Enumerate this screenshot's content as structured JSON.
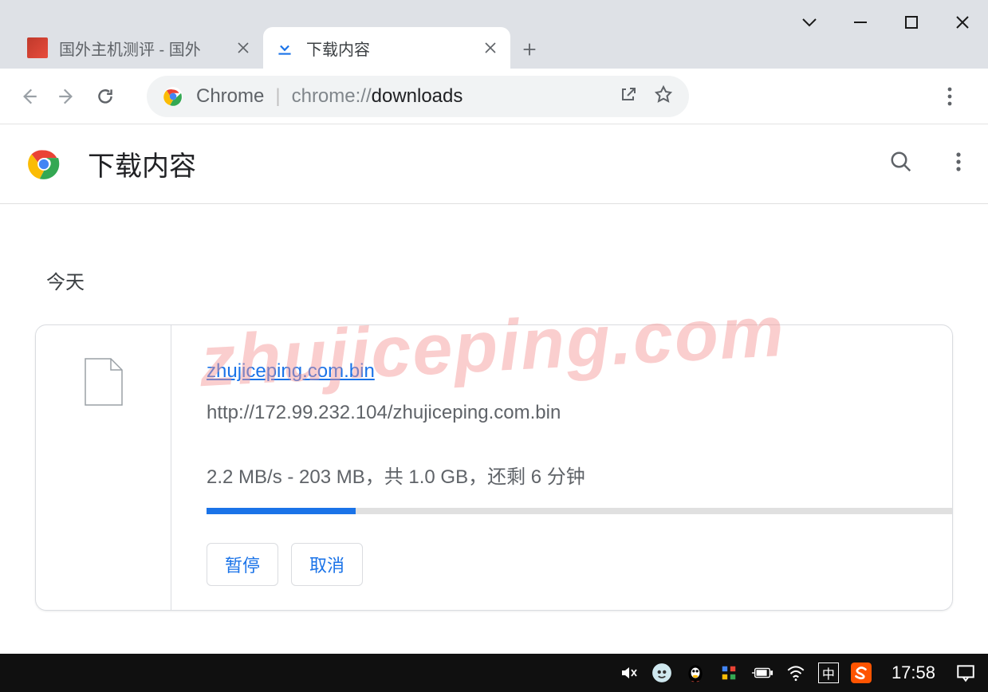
{
  "tabs": [
    {
      "title": "国外主机测评 - 国外",
      "active": false
    },
    {
      "title": "下载内容",
      "active": true
    }
  ],
  "omnibox": {
    "chip": "Chrome",
    "url_prefix": "chrome://",
    "url_bold": "downloads"
  },
  "page": {
    "title": "下载内容",
    "section": "今天"
  },
  "download": {
    "filename": "zhujiceping.com.bin",
    "url": "http://172.99.232.104/zhujiceping.com.bin",
    "status": "2.2 MB/s - 203 MB，共 1.0 GB，还剩 6 分钟",
    "progress_pct": 20,
    "btn_pause": "暂停",
    "btn_cancel": "取消"
  },
  "watermark": "zhujiceping.com",
  "taskbar": {
    "ime": "中",
    "time": "17:58"
  }
}
